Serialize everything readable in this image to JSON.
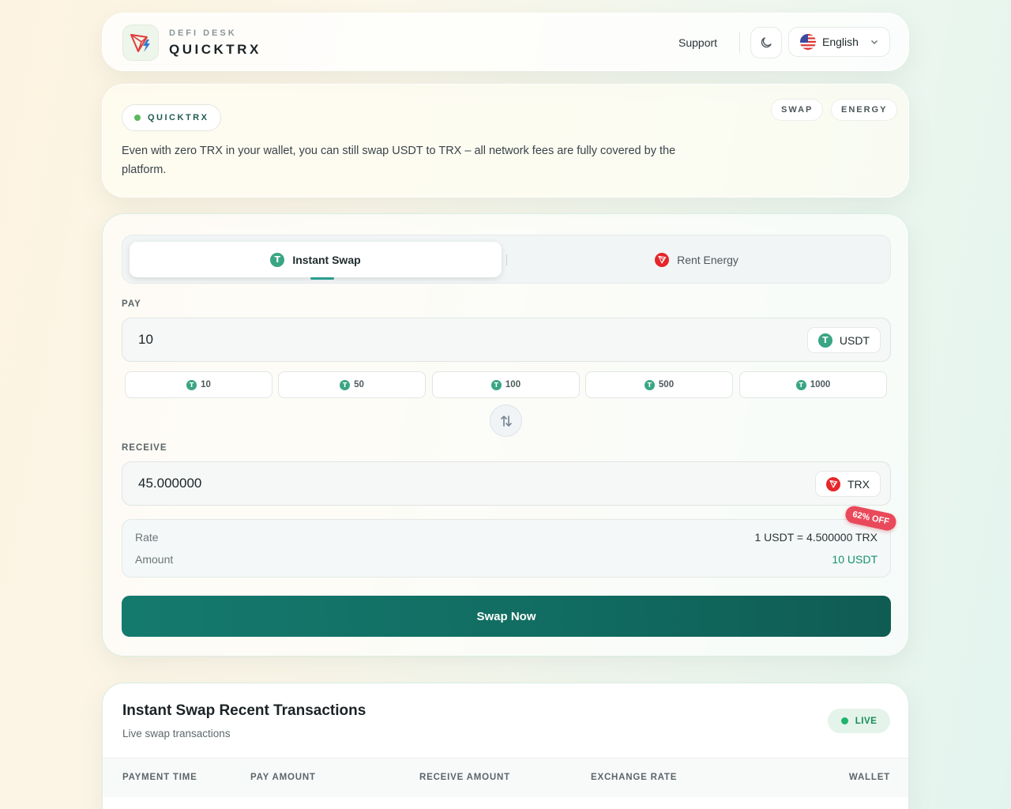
{
  "header": {
    "brand_sub": "DEFI DESK",
    "brand_title": "QUICKTRX",
    "support_label": "Support",
    "theme_icon": "moon-icon",
    "language_label": "English"
  },
  "info": {
    "pill_label": "QUICKTRX",
    "tags": [
      "SWAP",
      "ENERGY"
    ],
    "description": "Even with zero TRX in your wallet, you can still swap USDT to TRX – all network fees are fully covered by the platform."
  },
  "swap": {
    "tabs": [
      {
        "label": "Instant Swap",
        "active": true
      },
      {
        "label": "Rent Energy",
        "active": false
      }
    ],
    "pay_label": "PAY",
    "pay_value": "10",
    "pay_token": "USDT",
    "presets": [
      "10",
      "50",
      "100",
      "500",
      "1000"
    ],
    "receive_label": "RECEIVE",
    "receive_value": "45.000000",
    "receive_token": "TRX",
    "discount_badge": "62% OFF",
    "rate_label": "Rate",
    "rate_value": "1 USDT = 4.500000 TRX",
    "amount_label": "Amount",
    "amount_value": "10 USDT",
    "submit_label": "Swap Now"
  },
  "transactions": {
    "title": "Instant Swap Recent Transactions",
    "subtitle": "Live swap transactions",
    "live_label": "LIVE",
    "columns": [
      "PAYMENT TIME",
      "PAY AMOUNT",
      "RECEIVE AMOUNT",
      "EXCHANGE RATE",
      "WALLET"
    ]
  },
  "colors": {
    "primary": "#157a6e",
    "usdt": "#3aa584",
    "trx": "#e5262b",
    "badge": "#e9495a"
  }
}
